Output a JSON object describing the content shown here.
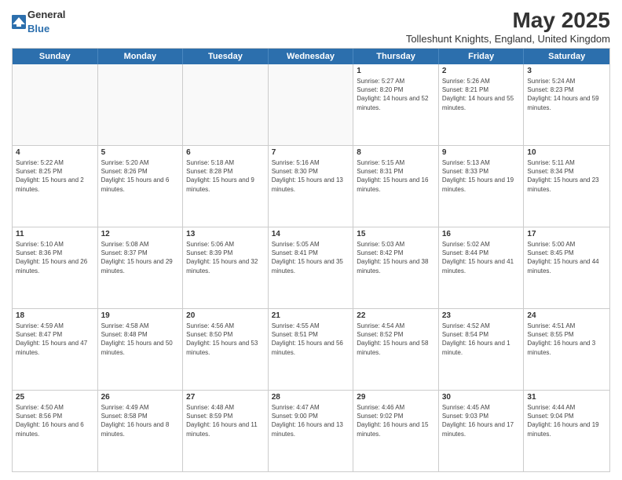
{
  "logo": {
    "text_general": "General",
    "text_blue": "Blue"
  },
  "title": "May 2025",
  "subtitle": "Tolleshunt Knights, England, United Kingdom",
  "day_headers": [
    "Sunday",
    "Monday",
    "Tuesday",
    "Wednesday",
    "Thursday",
    "Friday",
    "Saturday"
  ],
  "weeks": [
    [
      {
        "num": "",
        "info": ""
      },
      {
        "num": "",
        "info": ""
      },
      {
        "num": "",
        "info": ""
      },
      {
        "num": "",
        "info": ""
      },
      {
        "num": "1",
        "info": "Sunrise: 5:27 AM\nSunset: 8:20 PM\nDaylight: 14 hours and 52 minutes."
      },
      {
        "num": "2",
        "info": "Sunrise: 5:26 AM\nSunset: 8:21 PM\nDaylight: 14 hours and 55 minutes."
      },
      {
        "num": "3",
        "info": "Sunrise: 5:24 AM\nSunset: 8:23 PM\nDaylight: 14 hours and 59 minutes."
      }
    ],
    [
      {
        "num": "4",
        "info": "Sunrise: 5:22 AM\nSunset: 8:25 PM\nDaylight: 15 hours and 2 minutes."
      },
      {
        "num": "5",
        "info": "Sunrise: 5:20 AM\nSunset: 8:26 PM\nDaylight: 15 hours and 6 minutes."
      },
      {
        "num": "6",
        "info": "Sunrise: 5:18 AM\nSunset: 8:28 PM\nDaylight: 15 hours and 9 minutes."
      },
      {
        "num": "7",
        "info": "Sunrise: 5:16 AM\nSunset: 8:30 PM\nDaylight: 15 hours and 13 minutes."
      },
      {
        "num": "8",
        "info": "Sunrise: 5:15 AM\nSunset: 8:31 PM\nDaylight: 15 hours and 16 minutes."
      },
      {
        "num": "9",
        "info": "Sunrise: 5:13 AM\nSunset: 8:33 PM\nDaylight: 15 hours and 19 minutes."
      },
      {
        "num": "10",
        "info": "Sunrise: 5:11 AM\nSunset: 8:34 PM\nDaylight: 15 hours and 23 minutes."
      }
    ],
    [
      {
        "num": "11",
        "info": "Sunrise: 5:10 AM\nSunset: 8:36 PM\nDaylight: 15 hours and 26 minutes."
      },
      {
        "num": "12",
        "info": "Sunrise: 5:08 AM\nSunset: 8:37 PM\nDaylight: 15 hours and 29 minutes."
      },
      {
        "num": "13",
        "info": "Sunrise: 5:06 AM\nSunset: 8:39 PM\nDaylight: 15 hours and 32 minutes."
      },
      {
        "num": "14",
        "info": "Sunrise: 5:05 AM\nSunset: 8:41 PM\nDaylight: 15 hours and 35 minutes."
      },
      {
        "num": "15",
        "info": "Sunrise: 5:03 AM\nSunset: 8:42 PM\nDaylight: 15 hours and 38 minutes."
      },
      {
        "num": "16",
        "info": "Sunrise: 5:02 AM\nSunset: 8:44 PM\nDaylight: 15 hours and 41 minutes."
      },
      {
        "num": "17",
        "info": "Sunrise: 5:00 AM\nSunset: 8:45 PM\nDaylight: 15 hours and 44 minutes."
      }
    ],
    [
      {
        "num": "18",
        "info": "Sunrise: 4:59 AM\nSunset: 8:47 PM\nDaylight: 15 hours and 47 minutes."
      },
      {
        "num": "19",
        "info": "Sunrise: 4:58 AM\nSunset: 8:48 PM\nDaylight: 15 hours and 50 minutes."
      },
      {
        "num": "20",
        "info": "Sunrise: 4:56 AM\nSunset: 8:50 PM\nDaylight: 15 hours and 53 minutes."
      },
      {
        "num": "21",
        "info": "Sunrise: 4:55 AM\nSunset: 8:51 PM\nDaylight: 15 hours and 56 minutes."
      },
      {
        "num": "22",
        "info": "Sunrise: 4:54 AM\nSunset: 8:52 PM\nDaylight: 15 hours and 58 minutes."
      },
      {
        "num": "23",
        "info": "Sunrise: 4:52 AM\nSunset: 8:54 PM\nDaylight: 16 hours and 1 minute."
      },
      {
        "num": "24",
        "info": "Sunrise: 4:51 AM\nSunset: 8:55 PM\nDaylight: 16 hours and 3 minutes."
      }
    ],
    [
      {
        "num": "25",
        "info": "Sunrise: 4:50 AM\nSunset: 8:56 PM\nDaylight: 16 hours and 6 minutes."
      },
      {
        "num": "26",
        "info": "Sunrise: 4:49 AM\nSunset: 8:58 PM\nDaylight: 16 hours and 8 minutes."
      },
      {
        "num": "27",
        "info": "Sunrise: 4:48 AM\nSunset: 8:59 PM\nDaylight: 16 hours and 11 minutes."
      },
      {
        "num": "28",
        "info": "Sunrise: 4:47 AM\nSunset: 9:00 PM\nDaylight: 16 hours and 13 minutes."
      },
      {
        "num": "29",
        "info": "Sunrise: 4:46 AM\nSunset: 9:02 PM\nDaylight: 16 hours and 15 minutes."
      },
      {
        "num": "30",
        "info": "Sunrise: 4:45 AM\nSunset: 9:03 PM\nDaylight: 16 hours and 17 minutes."
      },
      {
        "num": "31",
        "info": "Sunrise: 4:44 AM\nSunset: 9:04 PM\nDaylight: 16 hours and 19 minutes."
      }
    ]
  ]
}
